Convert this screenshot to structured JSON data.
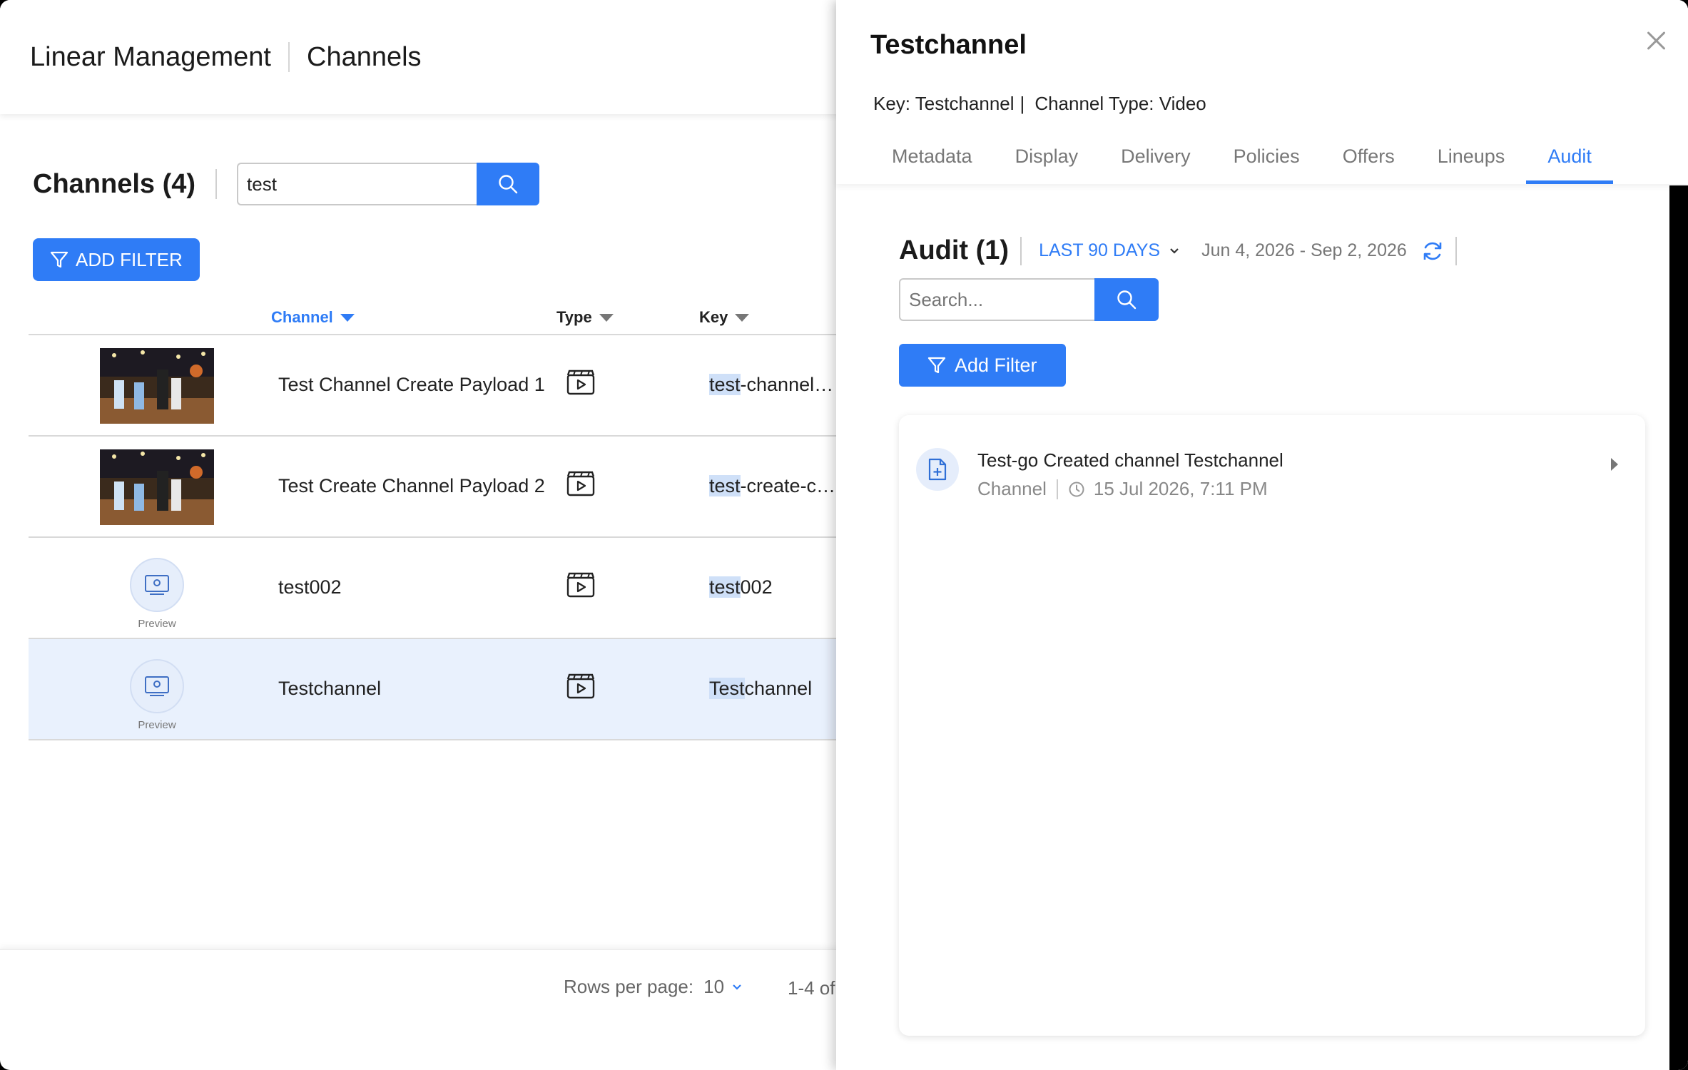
{
  "header": {
    "app_title": "Linear Management",
    "section_title": "Channels"
  },
  "list": {
    "title": "Channels (4)",
    "search_value": "test",
    "add_filter_label": "ADD FILTER",
    "columns": {
      "channel": "Channel",
      "type": "Type",
      "key": "Key"
    },
    "preview_label": "Preview",
    "rows": [
      {
        "name": "Test Channel Create Payload 1",
        "key_hl": "test",
        "key_rest": "-channel…"
      },
      {
        "name": "Test Create Channel Payload 2",
        "key_hl": "test",
        "key_rest": "-create-c…"
      },
      {
        "name": "test002",
        "key_hl": "test",
        "key_rest": "002"
      },
      {
        "name": "Testchannel",
        "key_hl": "Test",
        "key_rest": "channel"
      }
    ]
  },
  "footer": {
    "rows_per_page_label": "Rows per page:",
    "rows_per_page_value": "10",
    "range_text": "1-4 of"
  },
  "drawer": {
    "title": "Testchannel",
    "key_text": "Key: Testchannel",
    "meta_sep": "|",
    "channel_type_text": "Channel Type: Video",
    "tabs": [
      "Metadata",
      "Display",
      "Delivery",
      "Policies",
      "Offers",
      "Lineups",
      "Audit"
    ],
    "active_tab": "Audit",
    "audit": {
      "title": "Audit (1)",
      "range_label": "LAST 90 DAYS",
      "date_range": "Jun 4, 2026 - Sep 2, 2026",
      "search_placeholder": "Search...",
      "add_filter_label": "Add Filter",
      "entries": [
        {
          "title": "Test-go Created channel Testchannel",
          "category": "Channel",
          "timestamp": "15 Jul 2026, 7:11 PM"
        }
      ]
    }
  },
  "colors": {
    "accent": "#2f7cf6",
    "selected_row": "#e9f1fd"
  }
}
